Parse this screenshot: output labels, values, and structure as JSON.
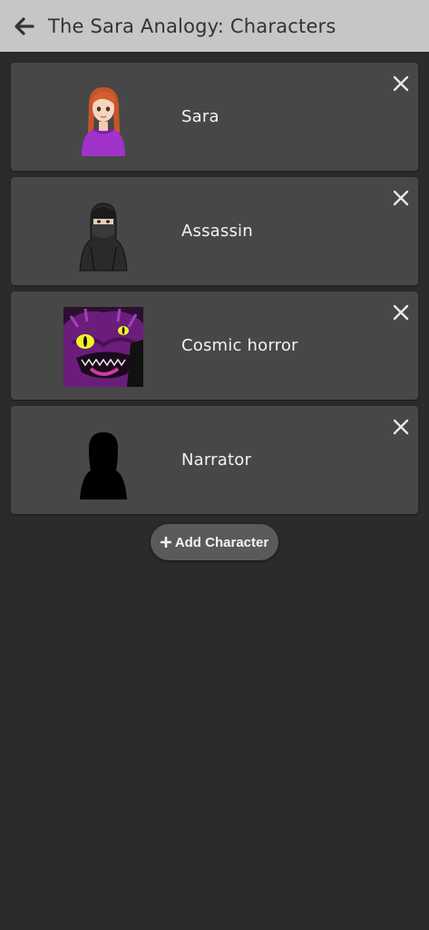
{
  "header": {
    "back_icon": "arrow-left-icon",
    "title": "The Sara Analogy: Characters"
  },
  "characters": [
    {
      "name": "Sara",
      "avatar": "girl-purple-sweater",
      "remove_icon": "close-icon"
    },
    {
      "name": "Assassin",
      "avatar": "masked-ninja",
      "remove_icon": "close-icon"
    },
    {
      "name": "Cosmic horror",
      "avatar": "purple-monster",
      "remove_icon": "close-icon"
    },
    {
      "name": "Narrator",
      "avatar": "black-silhouette",
      "remove_icon": "close-icon"
    }
  ],
  "add_button": {
    "icon": "plus-icon",
    "label": "Add Character"
  },
  "colors": {
    "background": "#2b2b2b",
    "header": "#c6c6c6",
    "card": "#474747",
    "button": "#5a5a5a",
    "text": "#f2f2f2"
  }
}
